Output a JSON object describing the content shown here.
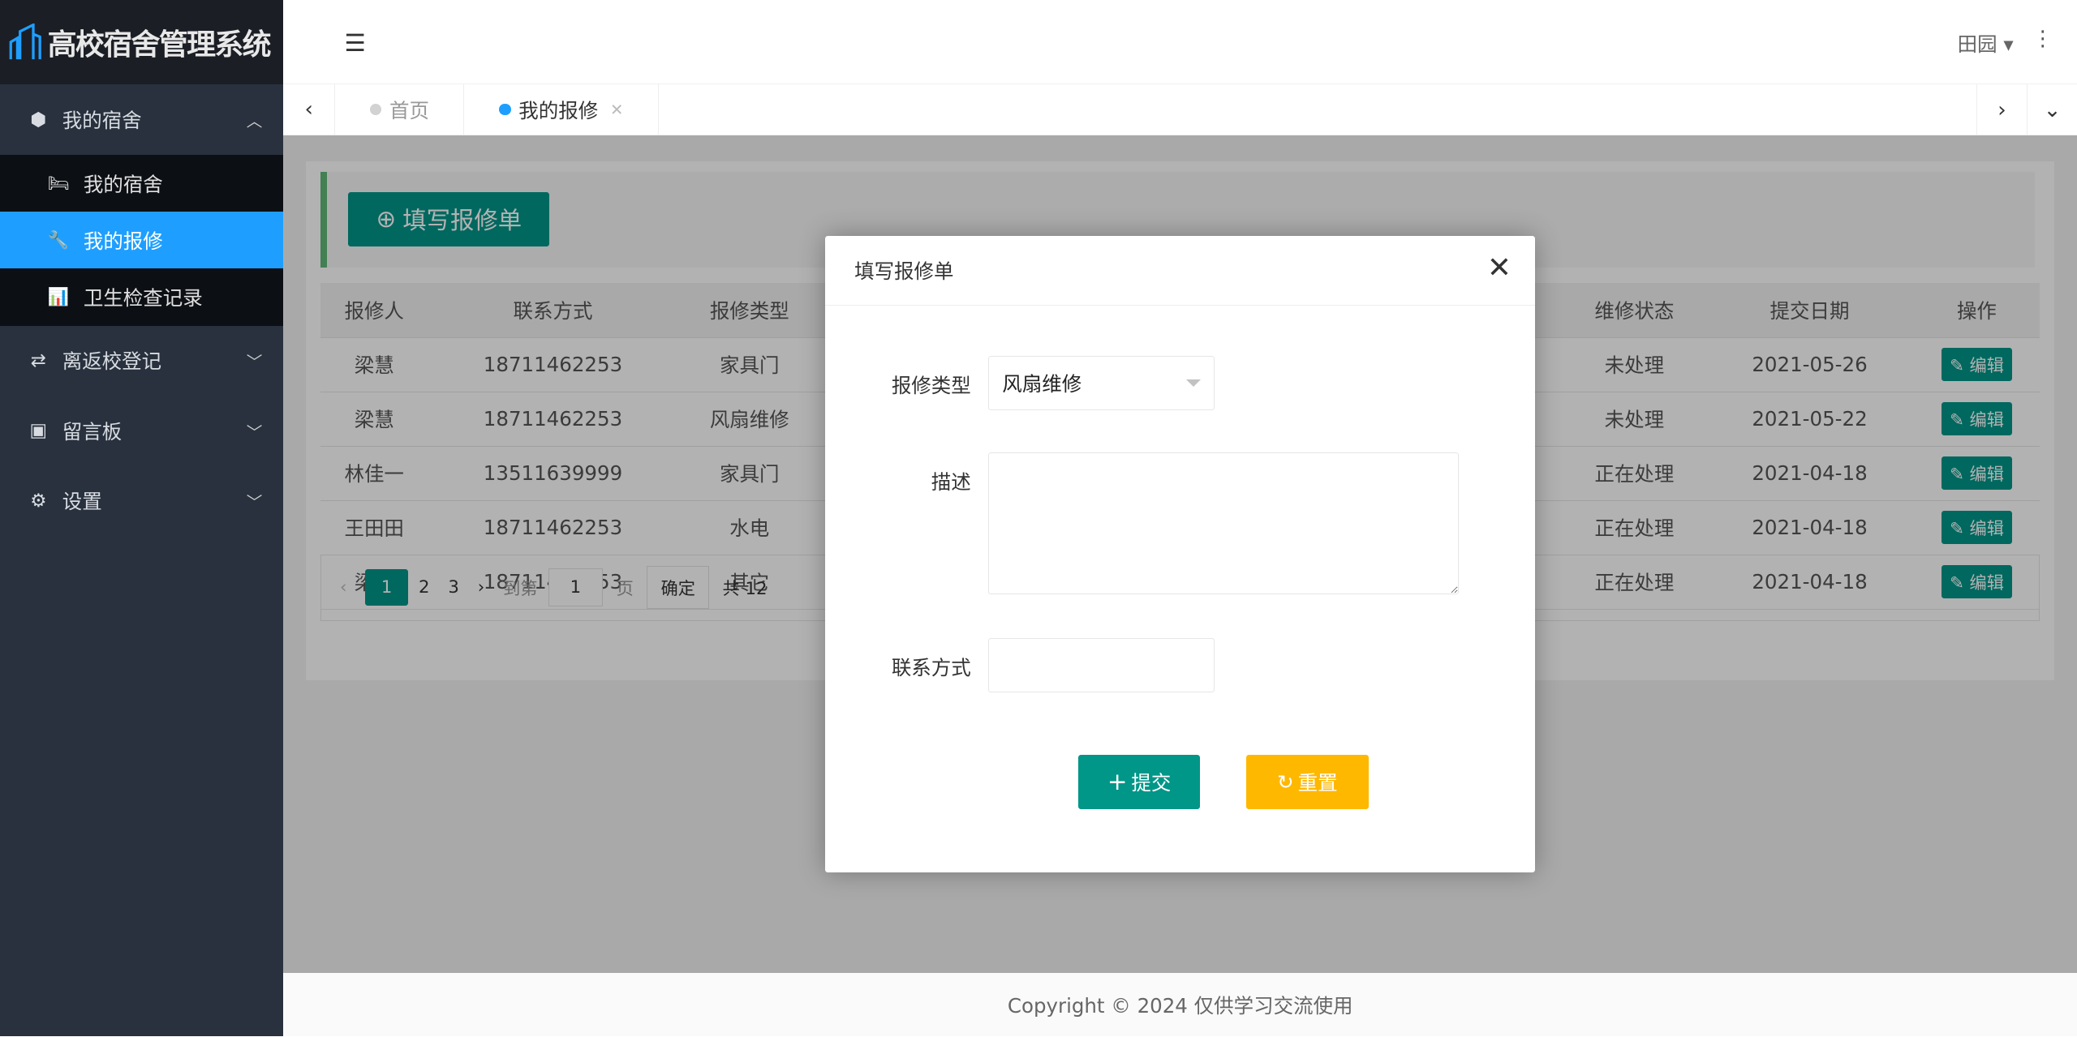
{
  "app": {
    "title": "高校宿舍管理系统"
  },
  "sidebar": {
    "items": [
      {
        "label": "我的宿舍",
        "icon": "cube-icon",
        "expanded": true,
        "children": [
          {
            "label": "我的宿舍",
            "icon": "bed-icon"
          },
          {
            "label": "我的报修",
            "icon": "wrench-icon",
            "active": true
          },
          {
            "label": "卫生检查记录",
            "icon": "bar-chart-icon"
          }
        ]
      },
      {
        "label": "离返校登记",
        "icon": "exchange-icon"
      },
      {
        "label": "留言板",
        "icon": "calendar-icon"
      },
      {
        "label": "设置",
        "icon": "gear-icon"
      }
    ]
  },
  "header": {
    "user": "田园"
  },
  "tabs": [
    {
      "label": "首页"
    },
    {
      "label": "我的报修"
    }
  ],
  "main": {
    "add_button": "填写报修单",
    "table": {
      "headers": [
        "报修人",
        "联系方式",
        "报修类型",
        "维修状态",
        "提交日期",
        "操作"
      ],
      "rows": [
        {
          "name": "梁慧",
          "phone": "18711462253",
          "type": "家具门",
          "status": "未处理",
          "date": "2021-05-26",
          "action": "编辑"
        },
        {
          "name": "梁慧",
          "phone": "18711462253",
          "type": "风扇维修",
          "status": "未处理",
          "date": "2021-05-22",
          "action": "编辑"
        },
        {
          "name": "林佳一",
          "phone": "13511639999",
          "type": "家具门",
          "status": "正在处理",
          "date": "2021-04-18",
          "action": "编辑"
        },
        {
          "name": "王田田",
          "phone": "18711462253",
          "type": "水电",
          "status": "正在处理",
          "date": "2021-04-18",
          "action": "编辑"
        },
        {
          "name": "梁慧",
          "phone": "18711462253",
          "type": "其它",
          "status": "正在处理",
          "date": "2021-04-18",
          "action": "编辑"
        }
      ]
    },
    "pager": {
      "pages": [
        "1",
        "2",
        "3"
      ],
      "current": "1",
      "goto_label": "到第",
      "goto_value": "1",
      "page_unit": "页",
      "confirm": "确定",
      "total": "共 12"
    }
  },
  "modal": {
    "title": "填写报修单",
    "type_label": "报修类型",
    "type_value": "风扇维修",
    "desc_label": "描述",
    "desc_value": "",
    "contact_label": "联系方式",
    "contact_value": "",
    "submit": "提交",
    "reset": "重置"
  },
  "footer": {
    "text": "Copyright © 2024 仅供学习交流使用"
  },
  "colors": {
    "primary": "#009688",
    "active": "#1e9fff",
    "warning": "#ffb800",
    "sidebar": "#28313d"
  }
}
